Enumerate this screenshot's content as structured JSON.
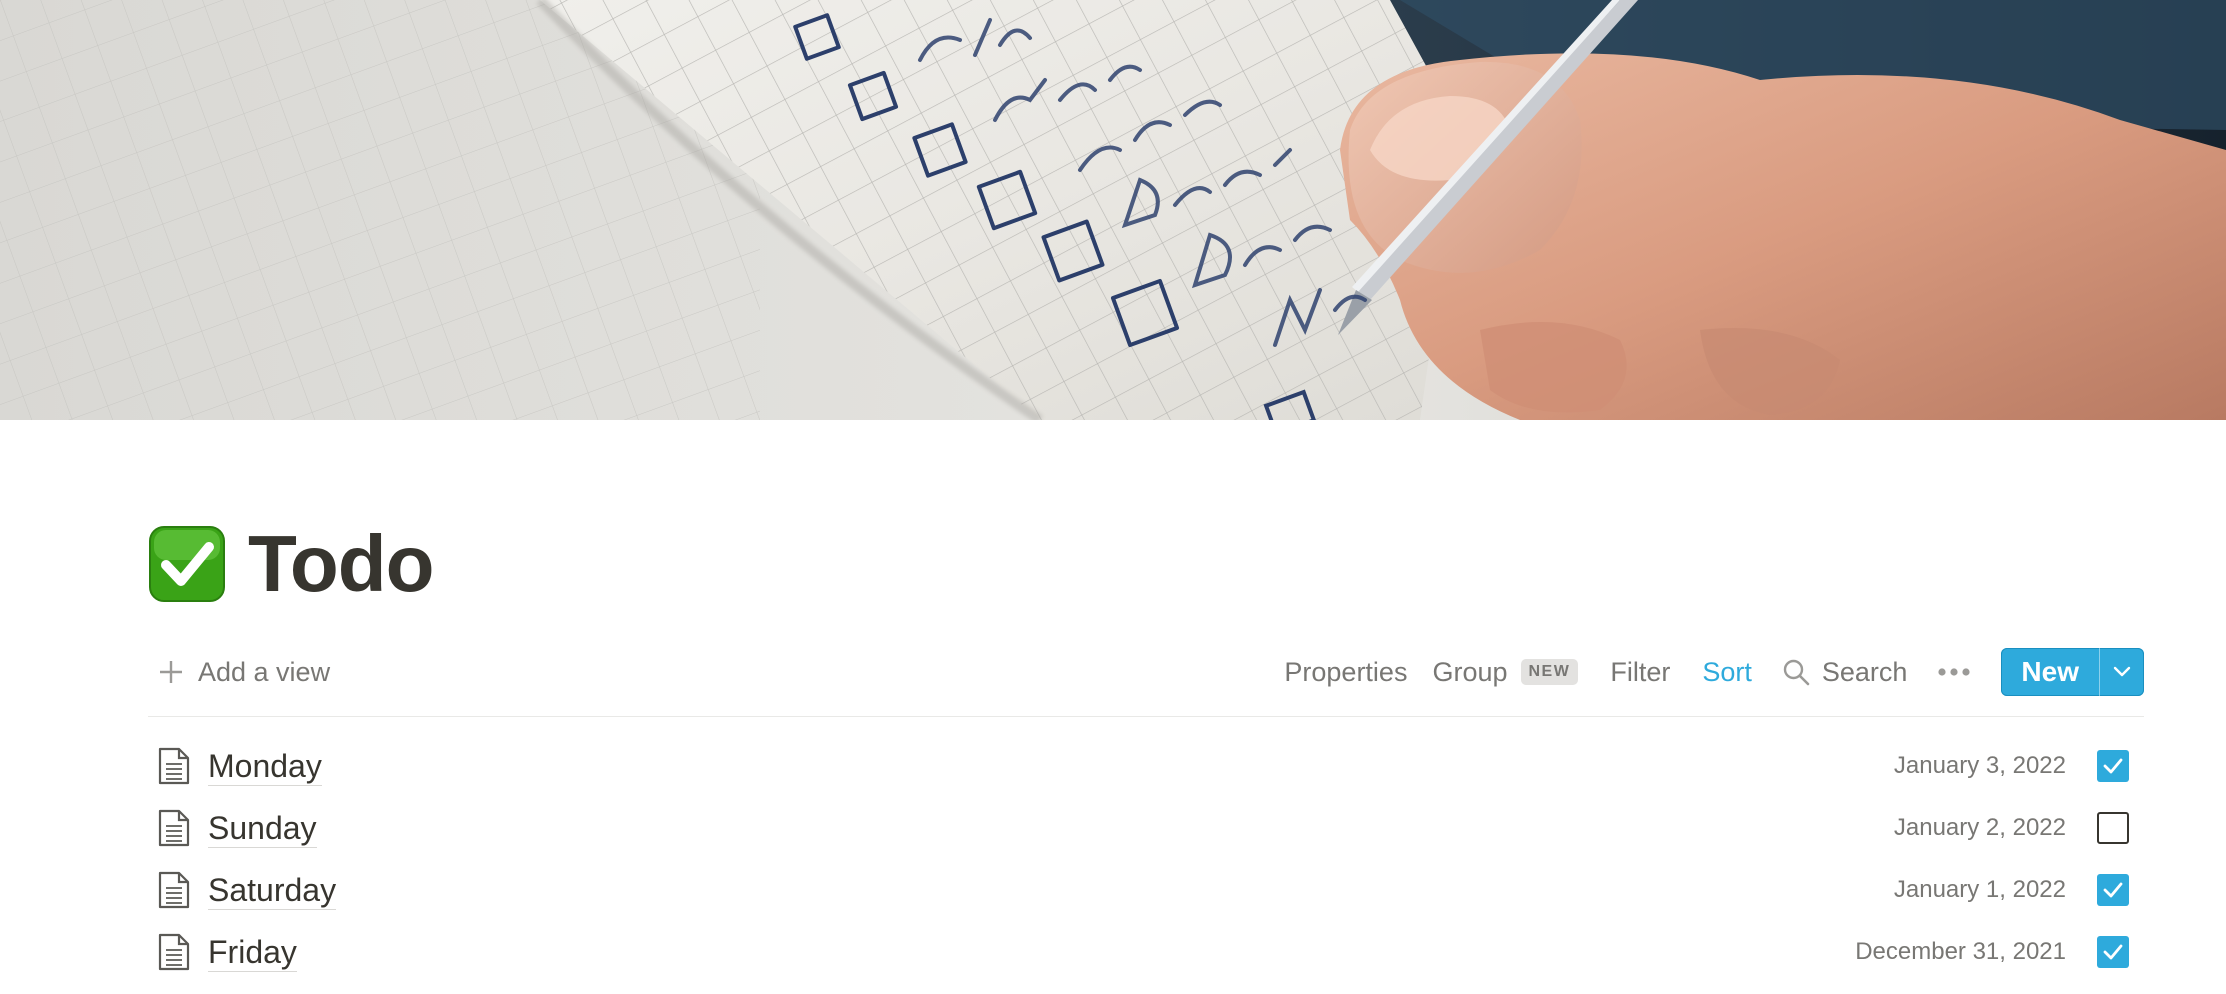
{
  "page": {
    "title": "Todo",
    "icon": "white-check-mark-emoji"
  },
  "cover": {
    "description_icon": "notebook-checklist-photo"
  },
  "toolbar": {
    "add_view_label": "Add a view",
    "properties_label": "Properties",
    "group_label": "Group",
    "group_badge": "NEW",
    "filter_label": "Filter",
    "sort_label": "Sort",
    "search_label": "Search",
    "new_label": "New"
  },
  "colors": {
    "accent": "#2eaadc",
    "text": "#37352f",
    "muted": "#787774",
    "badge_bg": "#e3e2e0"
  },
  "rows": [
    {
      "title": "Monday",
      "date": "January 3, 2022",
      "done": true
    },
    {
      "title": "Sunday",
      "date": "January 2, 2022",
      "done": false
    },
    {
      "title": "Saturday",
      "date": "January 1, 2022",
      "done": true
    },
    {
      "title": "Friday",
      "date": "December 31, 2021",
      "done": true
    }
  ]
}
